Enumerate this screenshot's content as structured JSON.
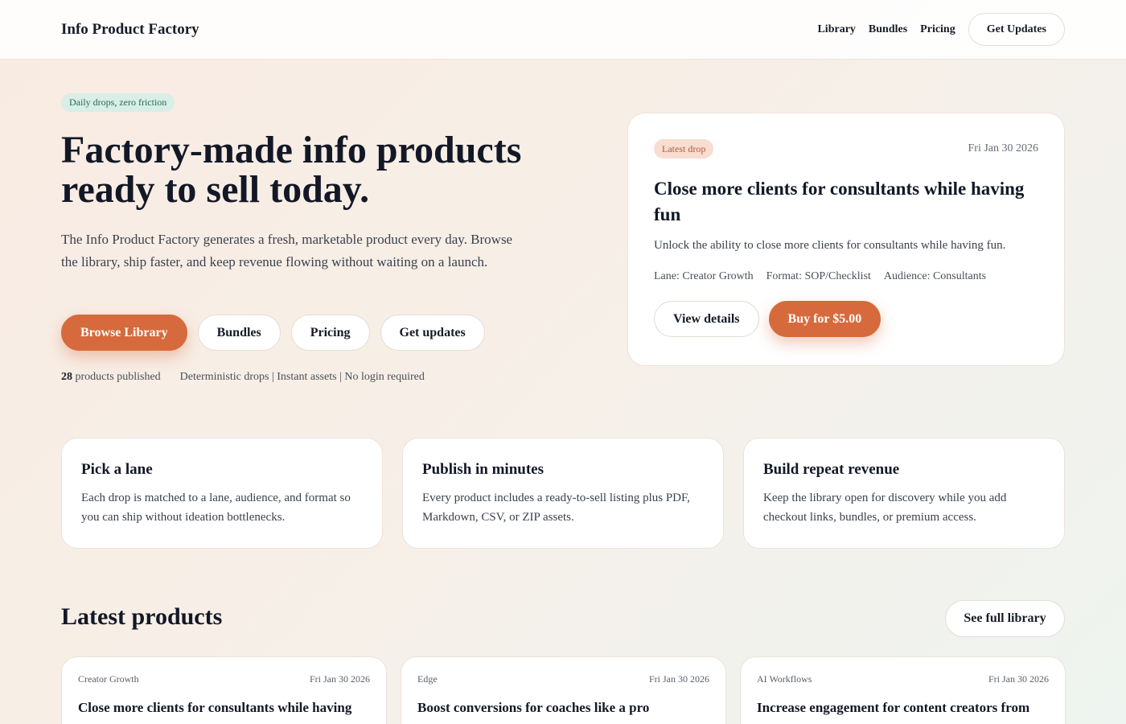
{
  "header": {
    "brand": "Info Product Factory",
    "nav": [
      "Library",
      "Bundles",
      "Pricing"
    ],
    "cta": "Get Updates"
  },
  "hero": {
    "tag": "Daily drops, zero friction",
    "title": "Factory-made info products ready to sell today.",
    "description": "The Info Product Factory generates a fresh, marketable product every day. Browse the library, ship faster, and keep revenue flowing without waiting on a launch.",
    "buttons": {
      "browse": "Browse Library",
      "bundles": "Bundles",
      "pricing": "Pricing",
      "updates": "Get updates"
    },
    "stats": {
      "count": "28",
      "count_label": "products published",
      "features": "Deterministic drops | Instant assets | No login required"
    }
  },
  "latest_drop": {
    "badge": "Latest drop",
    "date": "Fri Jan 30 2026",
    "title": "Close more clients for consultants while having fun",
    "description": "Unlock the ability to close more clients for consultants while having fun.",
    "lane": "Lane: Creator Growth",
    "format": "Format: SOP/Checklist",
    "audience": "Audience: Consultants",
    "details_label": "View details",
    "buy_label": "Buy for $5.00"
  },
  "features": [
    {
      "title": "Pick a lane",
      "text": "Each drop is matched to a lane, audience, and format so you can ship without ideation bottlenecks."
    },
    {
      "title": "Publish in minutes",
      "text": "Every product includes a ready-to-sell listing plus PDF, Markdown, CSV, or ZIP assets."
    },
    {
      "title": "Build repeat revenue",
      "text": "Keep the library open for discovery while you add checkout links, bundles, or premium access."
    }
  ],
  "latest_products": {
    "title": "Latest products",
    "see_all": "See full library",
    "items": [
      {
        "lane": "Creator Growth",
        "date": "Fri Jan 30 2026",
        "title": "Close more clients for consultants while having"
      },
      {
        "lane": "Edge",
        "date": "Fri Jan 30 2026",
        "title": "Boost conversions for coaches like a pro"
      },
      {
        "lane": "AI Workflows",
        "date": "Fri Jan 30 2026",
        "title": "Increase engagement for content creators from"
      }
    ]
  },
  "colors": {
    "accent": "#d66a3c",
    "tag_bg": "#d8eee7",
    "badge_bg": "#f8ddd1"
  }
}
